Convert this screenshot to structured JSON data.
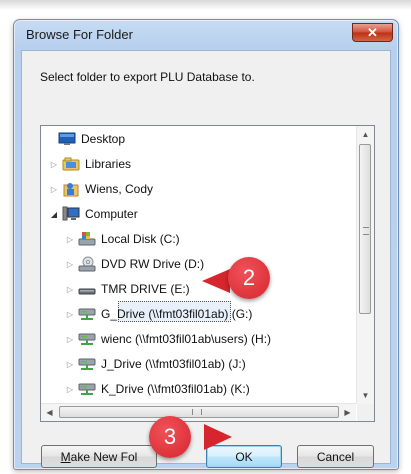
{
  "dialog": {
    "title": "Browse For Folder",
    "close_label": "✕",
    "instruction": "Select folder to export PLU Database to."
  },
  "tree": {
    "items": [
      {
        "label": "Desktop",
        "icon": "desktop-icon",
        "expander": ""
      },
      {
        "label": "Libraries",
        "icon": "libraries-icon",
        "expander": "▷"
      },
      {
        "label": "Wiens, Cody",
        "icon": "user-folder-icon",
        "expander": "▷"
      },
      {
        "label": "Computer",
        "icon": "computer-icon",
        "expander": "◢"
      },
      {
        "label": "Local Disk (C:)",
        "icon": "local-disk-icon",
        "expander": "▷"
      },
      {
        "label": "DVD RW Drive (D:)",
        "icon": "dvd-drive-icon",
        "expander": "▷"
      },
      {
        "label": "TMR DRIVE (E:)",
        "icon": "removable-drive-icon",
        "expander": "▷",
        "selected": true
      },
      {
        "label": "G_Drive (\\\\fmt03fil01ab) (G:)",
        "icon": "network-drive-icon",
        "expander": "▷"
      },
      {
        "label": "wienc (\\\\fmt03fil01ab\\users) (H:)",
        "icon": "network-drive-icon",
        "expander": "▷"
      },
      {
        "label": "J_Drive (\\\\fmt03fil01ab) (J:)",
        "icon": "network-drive-icon",
        "expander": "▷"
      },
      {
        "label": "K_Drive (\\\\fmt03fil01ab) (K:)",
        "icon": "network-drive-icon",
        "expander": "▷"
      }
    ]
  },
  "scrollbar": {
    "up": "▲",
    "down": "▼",
    "left": "◀",
    "right": "▶"
  },
  "buttons": {
    "make_new_folder_underlined": "M",
    "make_new_folder_rest": "ake New Fol",
    "ok": "OK",
    "cancel": "Cancel"
  },
  "callouts": {
    "step2": "2",
    "step3": "3"
  },
  "colors": {
    "callout": "#d7252d",
    "title_bar": "#b9d1ee",
    "close_button": "#c9412a"
  }
}
